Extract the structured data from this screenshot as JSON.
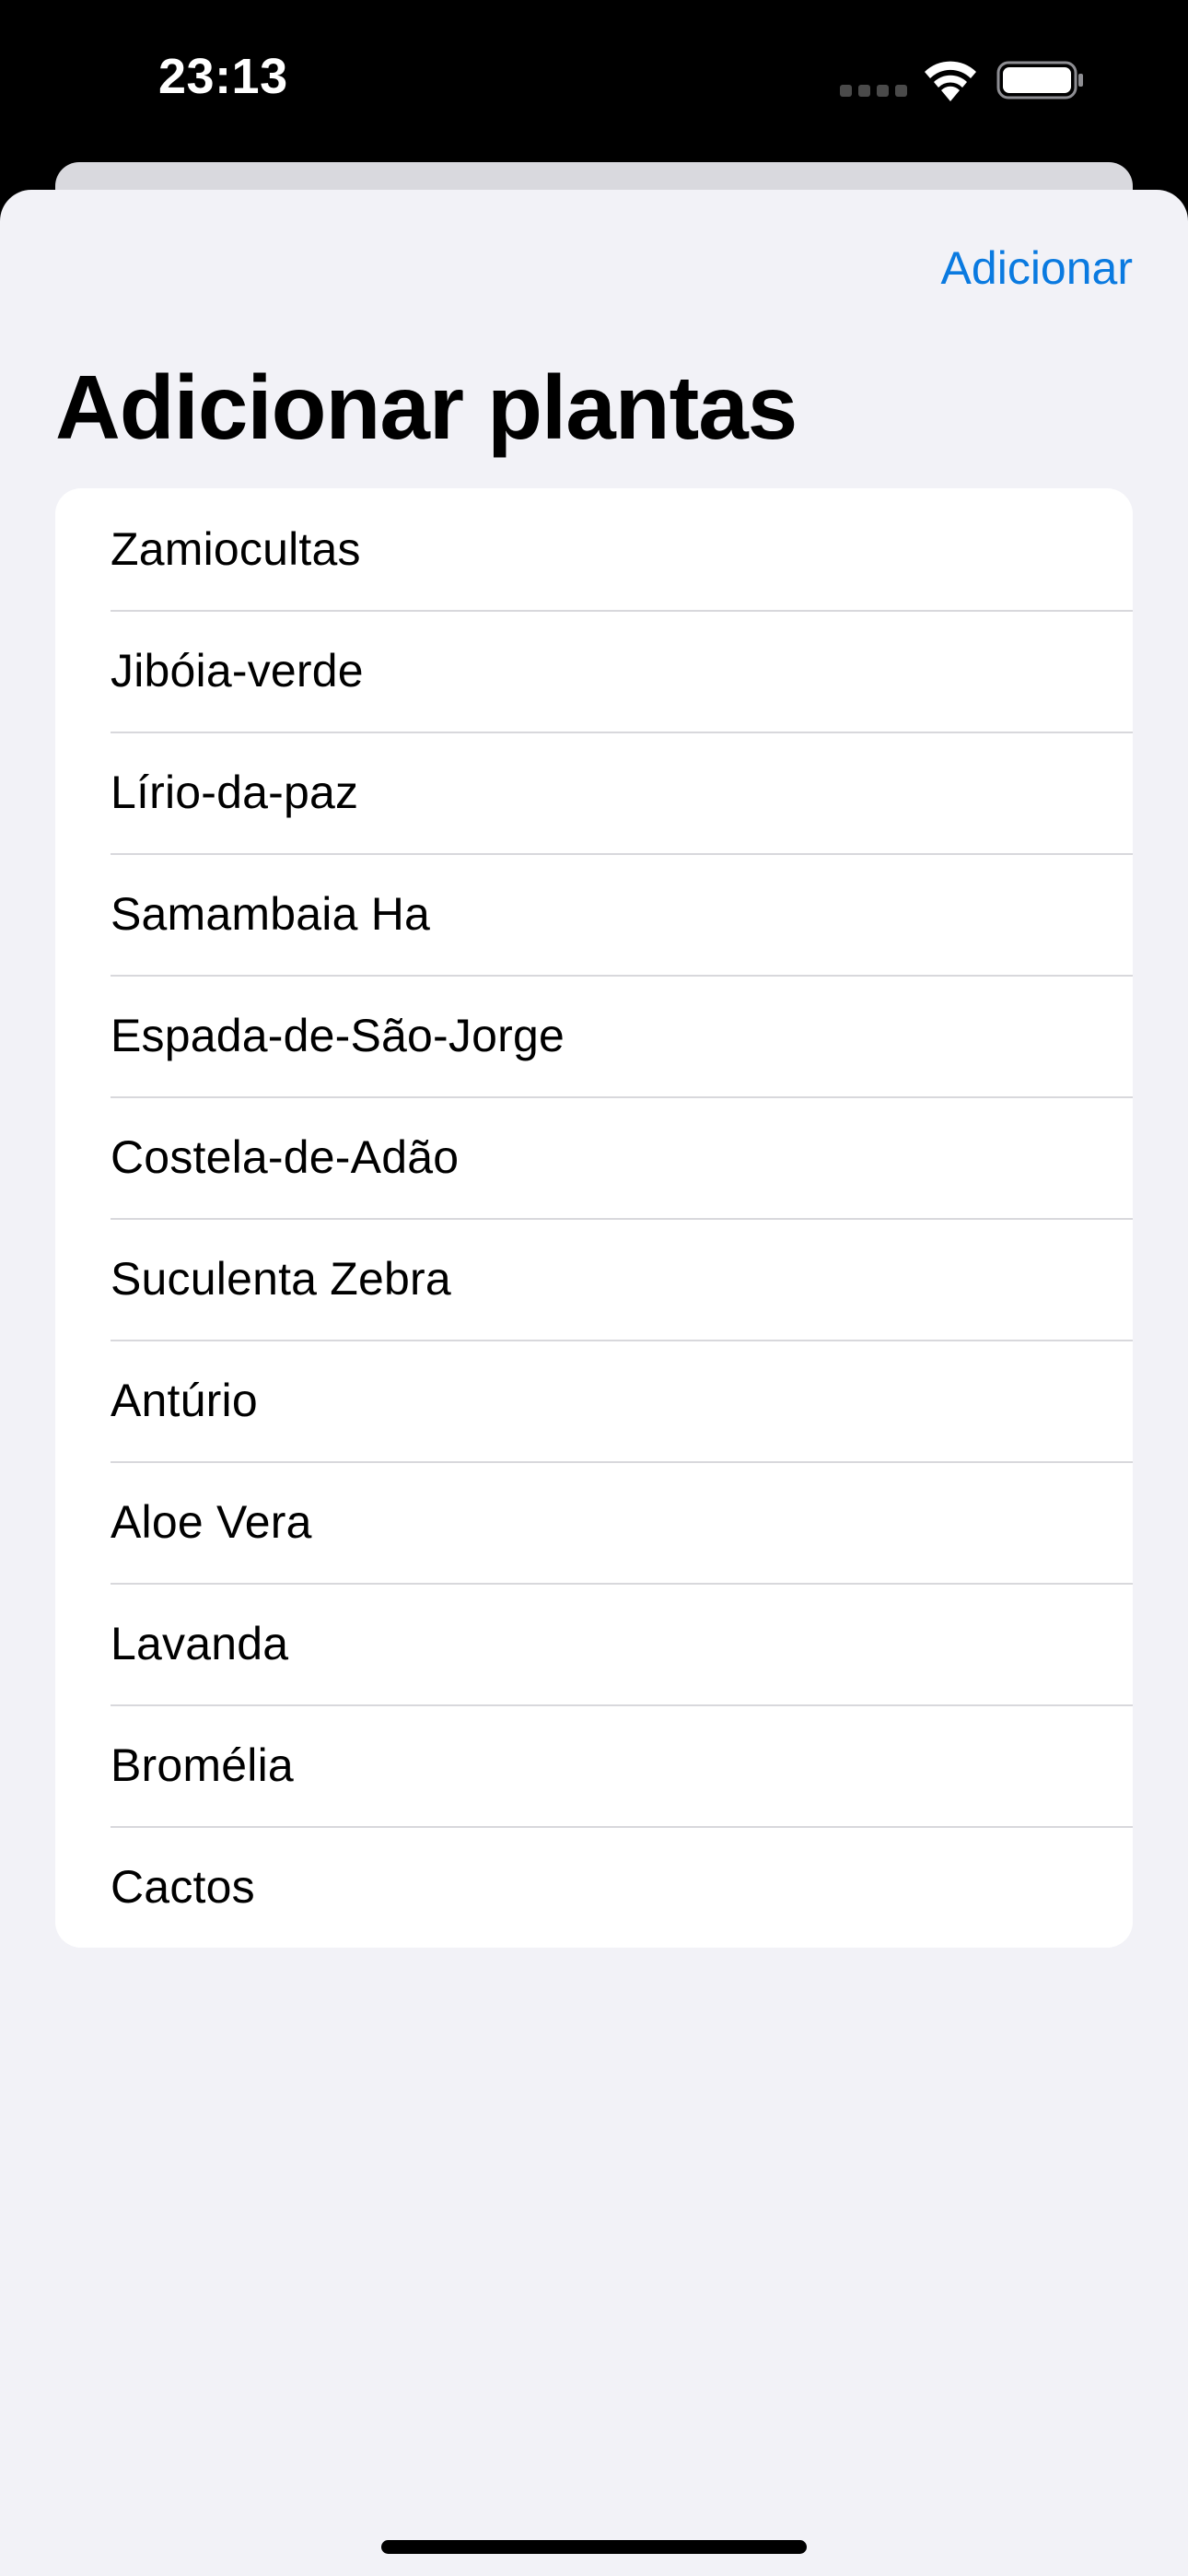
{
  "status_bar": {
    "time": "23:13",
    "icons": [
      "cellular-signal-icon",
      "wifi-icon",
      "battery-icon"
    ]
  },
  "navigation": {
    "add_button_label": "Adicionar"
  },
  "page": {
    "title": "Adicionar plantas"
  },
  "plants": [
    {
      "name": "Zamiocultas"
    },
    {
      "name": "Jibóia-verde"
    },
    {
      "name": "Lírio-da-paz"
    },
    {
      "name": "Samambaia Ha"
    },
    {
      "name": "Espada-de-São-Jorge"
    },
    {
      "name": "Costela-de-Adão"
    },
    {
      "name": "Suculenta Zebra"
    },
    {
      "name": "Antúrio"
    },
    {
      "name": "Aloe Vera"
    },
    {
      "name": "Lavanda"
    },
    {
      "name": "Bromélia"
    },
    {
      "name": "Cactos"
    }
  ],
  "colors": {
    "accent": "#0A7AE0",
    "sheet_background": "#F2F2F7",
    "list_background": "#FFFFFF",
    "separator": "#D8D8DC"
  }
}
